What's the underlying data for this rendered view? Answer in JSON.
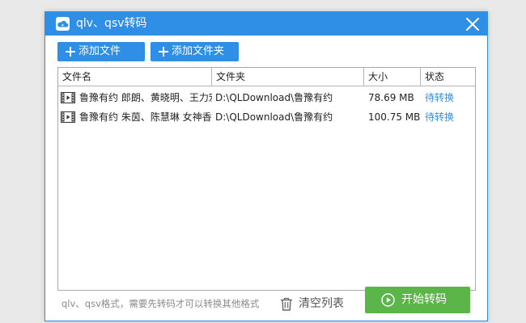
{
  "window": {
    "title": "qlv、qsv转码",
    "accent_color": "#2f8fe6",
    "icons": {
      "app": "cloud-video-icon",
      "close": "close-icon"
    }
  },
  "toolbar": {
    "add_file_label": "添加文件",
    "add_folder_label": "添加文件夹"
  },
  "table": {
    "headers": [
      "文件名",
      "文件夹",
      "大小",
      "状态"
    ],
    "rows": [
      {
        "name": "鲁豫有约 郎朗、黄晓明、王力宏",
        "folder": "D:\\QLDownload\\鲁豫有约",
        "size": "78.69 MB",
        "status": "待转换"
      },
      {
        "name": "鲁豫有约 朱茵、陈慧琳 女神香江",
        "folder": "D:\\QLDownload\\鲁豫有约",
        "size": "100.75 MB",
        "status": "待转换"
      }
    ]
  },
  "footer": {
    "note": "qlv、qsv格式，需要先转码才可以转换其他格式",
    "clear_label": "清空列表",
    "start_label": "开始转码",
    "start_color": "#5bb548"
  }
}
